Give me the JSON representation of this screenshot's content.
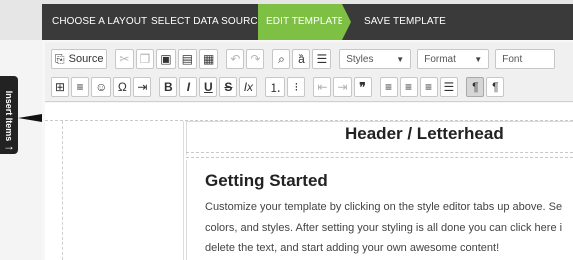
{
  "steps": {
    "choose_layout": "CHOOSE A LAYOUT",
    "select_data_source": "SELECT DATA SOURCE",
    "edit_template": "EDIT TEMPLATE",
    "save_template": "SAVE TEMPLATE"
  },
  "insert_items_label": "Insert Items",
  "toolbar": {
    "source_label": "Source",
    "styles_label": "Styles",
    "format_label": "Format",
    "font_label": "Font",
    "icons_row1": [
      "source-icon",
      "cut-icon",
      "copy-icon",
      "paste-icon",
      "paste-text-icon",
      "paste-word-icon",
      "undo-icon",
      "redo-icon",
      "find-icon",
      "replace-icon",
      "select-all-icon"
    ],
    "icons_row2": [
      "table-icon",
      "horizontal-line-icon",
      "smiley-icon",
      "special-char-icon",
      "page-break-icon",
      "bold-icon",
      "italic-icon",
      "underline-icon",
      "strike-icon",
      "remove-format-icon",
      "numbered-list-icon",
      "bulleted-list-icon",
      "outdent-icon",
      "indent-icon",
      "blockquote-icon",
      "align-left-icon",
      "align-center-icon",
      "align-right-icon",
      "justify-icon",
      "ltr-icon",
      "rtl-icon"
    ]
  },
  "document": {
    "header": "Header / Letterhead",
    "title": "Getting Started",
    "line1": "Customize your template by clicking on the style editor tabs up above. Se",
    "line2": "colors, and styles. After setting your styling is all done you can click here i",
    "line3": "delete the text, and start adding your own awesome content!"
  },
  "colors": {
    "active_step": "#7dc043",
    "step_bar": "#3a3a3a"
  }
}
